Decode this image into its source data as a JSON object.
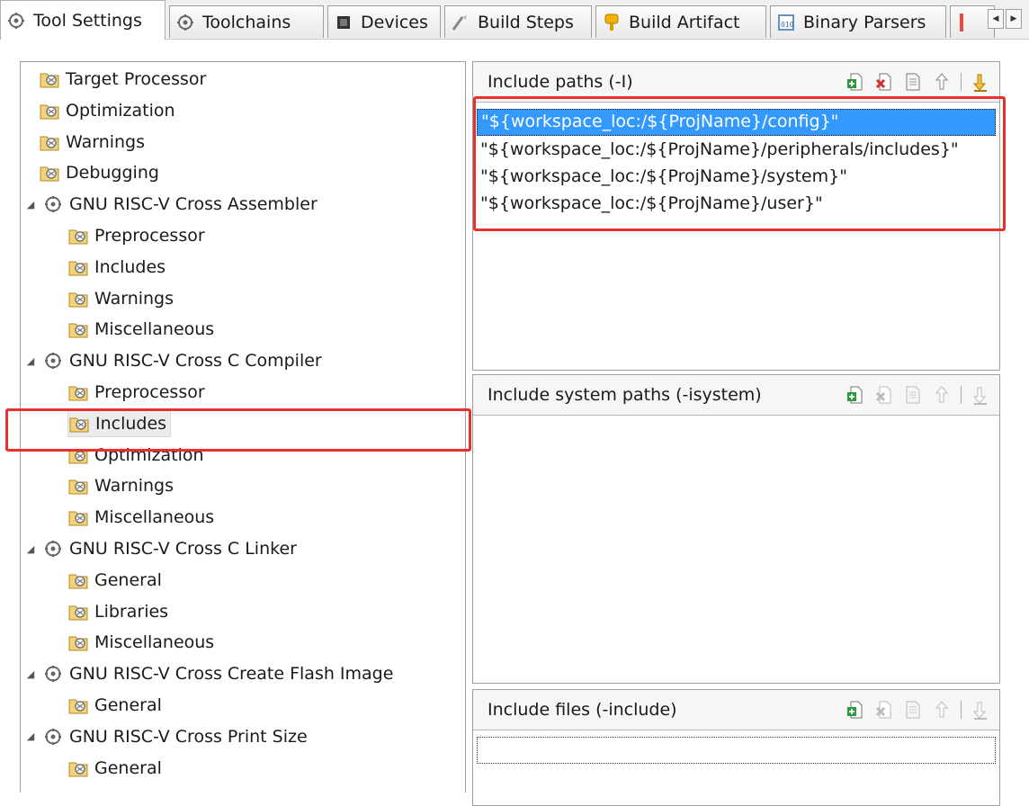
{
  "tabs": [
    {
      "label": "Tool Settings",
      "icon": "gear-wrench-icon",
      "active": true
    },
    {
      "label": "Toolchains",
      "icon": "gear-wrench-icon"
    },
    {
      "label": "Devices",
      "icon": "chip-icon"
    },
    {
      "label": "Build Steps",
      "icon": "steps-icon"
    },
    {
      "label": "Build Artifact",
      "icon": "artifact-icon"
    },
    {
      "label": "Binary Parsers",
      "icon": "binary-icon"
    }
  ],
  "tree": {
    "items": [
      {
        "label": "Target Processor",
        "level": 1,
        "kind": "page"
      },
      {
        "label": "Optimization",
        "level": 1,
        "kind": "page"
      },
      {
        "label": "Warnings",
        "level": 1,
        "kind": "page"
      },
      {
        "label": "Debugging",
        "level": 1,
        "kind": "page"
      },
      {
        "label": "GNU RISC-V Cross Assembler",
        "level": 0,
        "kind": "tool"
      },
      {
        "label": "Preprocessor",
        "level": 2,
        "kind": "page"
      },
      {
        "label": "Includes",
        "level": 2,
        "kind": "page"
      },
      {
        "label": "Warnings",
        "level": 2,
        "kind": "page"
      },
      {
        "label": "Miscellaneous",
        "level": 2,
        "kind": "page"
      },
      {
        "label": "GNU RISC-V Cross C Compiler",
        "level": 0,
        "kind": "tool"
      },
      {
        "label": "Preprocessor",
        "level": 2,
        "kind": "page"
      },
      {
        "label": "Includes",
        "level": 2,
        "kind": "page",
        "selected": true
      },
      {
        "label": "Optimization",
        "level": 2,
        "kind": "page"
      },
      {
        "label": "Warnings",
        "level": 2,
        "kind": "page"
      },
      {
        "label": "Miscellaneous",
        "level": 2,
        "kind": "page"
      },
      {
        "label": "GNU RISC-V Cross C Linker",
        "level": 0,
        "kind": "tool"
      },
      {
        "label": "General",
        "level": 2,
        "kind": "page"
      },
      {
        "label": "Libraries",
        "level": 2,
        "kind": "page"
      },
      {
        "label": "Miscellaneous",
        "level": 2,
        "kind": "page"
      },
      {
        "label": "GNU RISC-V Cross Create Flash Image",
        "level": 0,
        "kind": "tool"
      },
      {
        "label": "General",
        "level": 2,
        "kind": "page"
      },
      {
        "label": "GNU RISC-V Cross Print Size",
        "level": 0,
        "kind": "tool"
      },
      {
        "label": "General",
        "level": 2,
        "kind": "page"
      }
    ]
  },
  "panels": {
    "include_paths": {
      "title": "Include paths (-I)",
      "items": [
        "\"${workspace_loc:/${ProjName}/config}\"",
        "\"${workspace_loc:/${ProjName}/peripherals/includes}\"",
        "\"${workspace_loc:/${ProjName}/system}\"",
        "\"${workspace_loc:/${ProjName}/user}\""
      ]
    },
    "include_system_paths": {
      "title": "Include system paths (-isystem)",
      "items": []
    },
    "include_files": {
      "title": "Include files (-include)",
      "items": []
    }
  },
  "colors": {
    "selection": "#3399ff",
    "highlight": "#e8302c"
  },
  "toolbar_icons": [
    "add-icon",
    "delete-icon",
    "edit-icon",
    "move-up-icon",
    "move-down-icon"
  ]
}
